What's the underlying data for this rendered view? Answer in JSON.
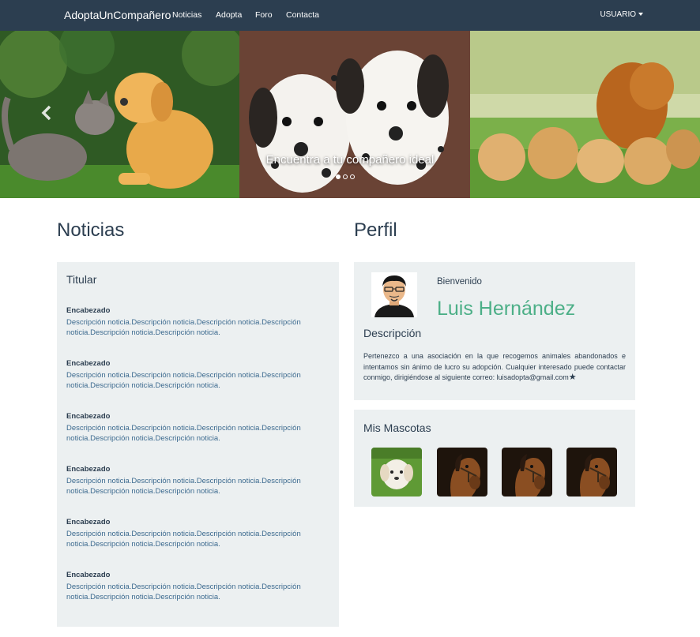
{
  "navbar": {
    "brand": "AdoptaUnCompañero",
    "links": [
      "Noticias",
      "Adopta",
      "Foro",
      "Contacta"
    ],
    "user_menu": "USUARIO"
  },
  "carousel": {
    "caption": "Encuentra a tu compañero ideal",
    "slides": [
      "cat-and-puppy-photo",
      "dalmatian-puppies-photo",
      "golden-retriever-family-photo"
    ],
    "indicator_count": 3,
    "active_indicator": 0
  },
  "news": {
    "section_title": "Noticias",
    "panel_title": "Titular",
    "items": [
      {
        "heading": "Encabezado",
        "description": "Descripción noticia.Descripción noticia.Descripción noticia.Descripción noticia.Descripción noticia.Descripción noticia."
      },
      {
        "heading": "Encabezado",
        "description": "Descripción noticia.Descripción noticia.Descripción noticia.Descripción noticia.Descripción noticia.Descripción noticia."
      },
      {
        "heading": "Encabezado",
        "description": "Descripción noticia.Descripción noticia.Descripción noticia.Descripción noticia.Descripción noticia.Descripción noticia."
      },
      {
        "heading": "Encabezado",
        "description": "Descripción noticia.Descripción noticia.Descripción noticia.Descripción noticia.Descripción noticia.Descripción noticia."
      },
      {
        "heading": "Encabezado",
        "description": "Descripción noticia.Descripción noticia.Descripción noticia.Descripción noticia.Descripción noticia.Descripción noticia."
      },
      {
        "heading": "Encabezado",
        "description": "Descripción noticia.Descripción noticia.Descripción noticia.Descripción noticia.Descripción noticia.Descripción noticia."
      }
    ]
  },
  "profile": {
    "section_title": "Perfil",
    "welcome": "Bienvenido",
    "name": "Luis Hernández",
    "description_title": "Descripción",
    "description": "Pertenezco a una asociación en la que recogemos animales abandonados e intentamos sin ánimo de lucro su adopción. Cualquier interesado puede contactar conmigo, dirigiéndose al siguiente correo: luisadopta@gmail.com",
    "star": "★"
  },
  "pets": {
    "title": "Mis Mascotas",
    "items": [
      "white-puppy-photo",
      "horse-photo",
      "horse-photo",
      "horse-photo"
    ]
  },
  "colors": {
    "navbar": "#2c3e50",
    "panel": "#ecf0f1",
    "name_accent": "#4caf87",
    "link_text": "#3c6a8f"
  }
}
